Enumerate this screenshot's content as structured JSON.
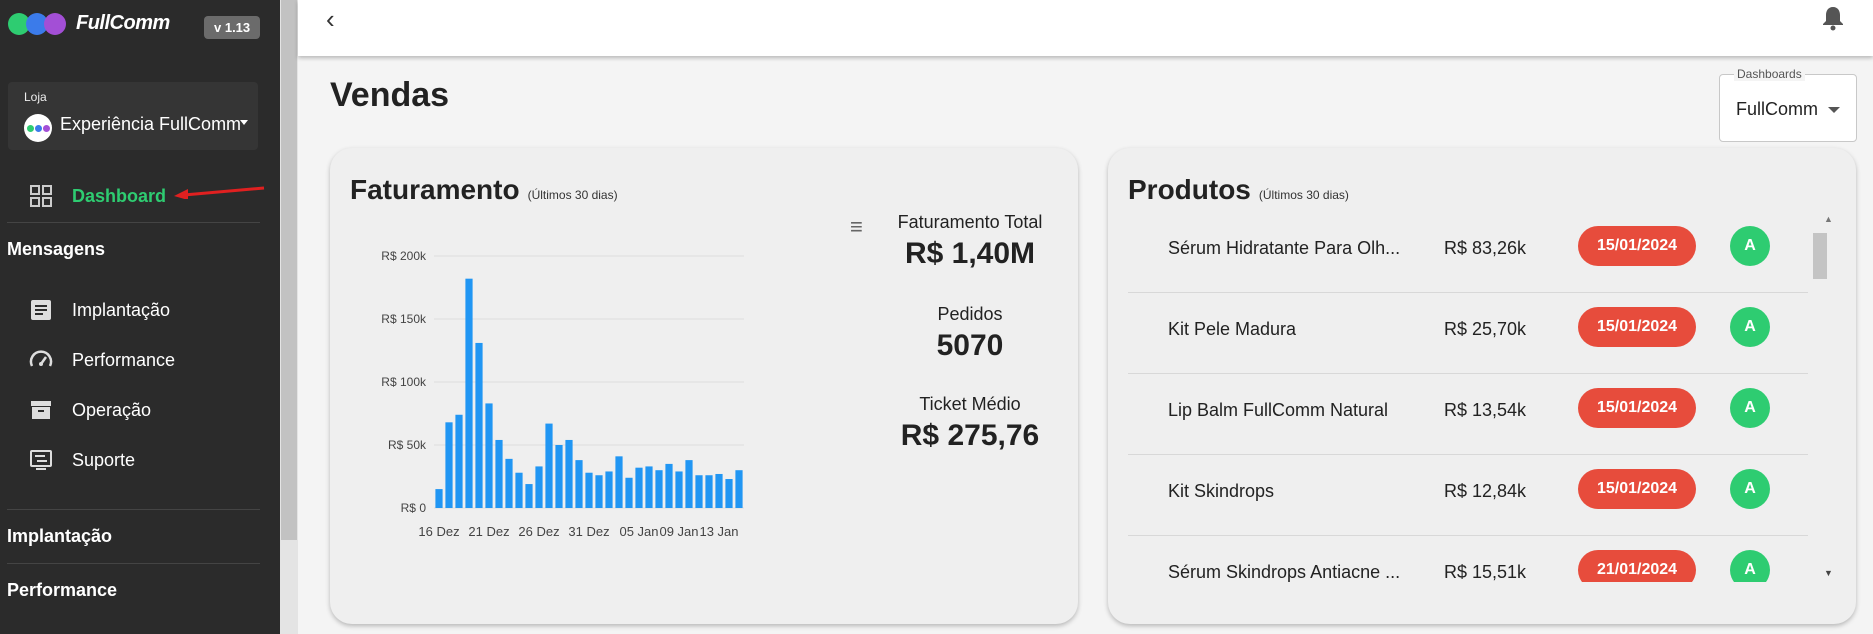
{
  "sidebar": {
    "brand": "FullComm",
    "version": "v 1.13",
    "logo_colors": [
      "#2ecc71",
      "#3b7bea",
      "#a34fd6"
    ],
    "store": {
      "label": "Loja",
      "name": "Experiência FullComm"
    },
    "dashboard_label": "Dashboard",
    "section_mensagens": "Mensagens",
    "items": [
      {
        "label": "Implantação",
        "icon": "document-icon"
      },
      {
        "label": "Performance",
        "icon": "gauge-icon"
      },
      {
        "label": "Operação",
        "icon": "archive-icon"
      },
      {
        "label": "Suporte",
        "icon": "support-icon"
      }
    ],
    "section_implantacao": "Implantação",
    "section_performance": "Performance",
    "accent": "#2ecc71"
  },
  "page": {
    "title": "Vendas"
  },
  "dashboards_select": {
    "legend": "Dashboards",
    "value": "FullComm"
  },
  "faturamento": {
    "title": "Faturamento",
    "subtitle": "(Últimos 30 dias)",
    "stats": {
      "total_label": "Faturamento Total",
      "total_value": "R$ 1,40M",
      "pedidos_label": "Pedidos",
      "pedidos_value": "5070",
      "ticket_label": "Ticket Médio",
      "ticket_value": "R$ 275,76"
    }
  },
  "produtos": {
    "title": "Produtos",
    "subtitle": "(Últimos 30 dias)",
    "rows": [
      {
        "name": "Sérum Hidratante Para Olh...",
        "value": "R$ 83,26k",
        "date": "15/01/2024",
        "badge": "A"
      },
      {
        "name": "Kit Pele Madura",
        "value": "R$ 25,70k",
        "date": "15/01/2024",
        "badge": "A"
      },
      {
        "name": "Lip Balm FullComm Natural",
        "value": "R$ 13,54k",
        "date": "15/01/2024",
        "badge": "A"
      },
      {
        "name": "Kit Skindrops",
        "value": "R$ 12,84k",
        "date": "15/01/2024",
        "badge": "A"
      },
      {
        "name": "Sérum Skindrops Antiacne ...",
        "value": "R$ 15,51k",
        "date": "21/01/2024",
        "badge": "A"
      }
    ]
  },
  "chart_data": {
    "type": "bar",
    "title": "",
    "xlabel": "",
    "ylabel": "",
    "ylim": [
      0,
      200000
    ],
    "y_ticks": [
      0,
      50000,
      100000,
      150000,
      200000
    ],
    "y_tick_labels": [
      "R$ 0",
      "R$ 50k",
      "R$ 100k",
      "R$ 150k",
      "R$ 200k"
    ],
    "x_tick_labels": [
      "16 Dez",
      "21 Dez",
      "26 Dez",
      "31 Dez",
      "05 Jan",
      "09 Jan",
      "13 Jan"
    ],
    "x_tick_indices": [
      0,
      5,
      10,
      15,
      20,
      24,
      28
    ],
    "grid": true,
    "color": "#2196f3",
    "values": [
      15000,
      68000,
      74000,
      182000,
      131000,
      83000,
      54000,
      39000,
      28000,
      19000,
      33000,
      67000,
      50000,
      54000,
      38000,
      28000,
      26000,
      29000,
      41000,
      24000,
      32000,
      33000,
      30000,
      35000,
      29000,
      38000,
      26000,
      26000,
      27000,
      23000,
      30000
    ]
  }
}
